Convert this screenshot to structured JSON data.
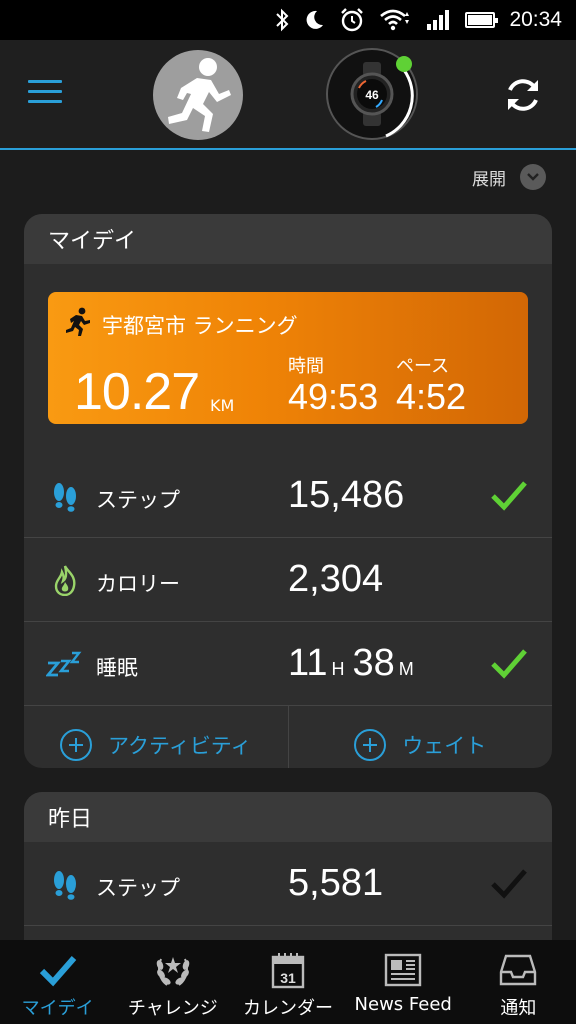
{
  "status_bar": {
    "time": "20:34"
  },
  "header": {
    "menu_icon": "hamburger-icon",
    "avatar_icon": "runner-avatar",
    "device_icon": "watch-device",
    "device_time": "46",
    "sync_icon": "sync-icon",
    "accent_color": "#2a9fd8"
  },
  "expand": {
    "label": "展開"
  },
  "my_day": {
    "title": "マイデイ",
    "activity": {
      "title": "宇都宮市 ランニング",
      "distance": "10.27",
      "distance_unit": "KM",
      "time_label": "時間",
      "time_value": "49:53",
      "pace_label": "ペース",
      "pace_value": "4:52",
      "color_start": "#f99a12",
      "color_end": "#d26705"
    },
    "stats": [
      {
        "label": "ステップ",
        "value": "15,486",
        "icon": "footsteps-icon",
        "checked": true
      },
      {
        "label": "カロリー",
        "value": "2,304",
        "icon": "flame-icon",
        "checked": false
      },
      {
        "label": "睡眠",
        "hours": "11",
        "hours_unit": "H",
        "minutes": "38",
        "minutes_unit": "M",
        "icon": "sleep-icon",
        "checked": true
      }
    ],
    "actions": [
      {
        "label": "アクティビティ"
      },
      {
        "label": "ウェイト"
      }
    ]
  },
  "yesterday": {
    "title": "昨日",
    "stats": [
      {
        "label": "ステップ",
        "value": "5,581",
        "icon": "footsteps-icon",
        "checked": false
      }
    ]
  },
  "bottom_nav": [
    {
      "label": "マイデイ",
      "icon": "check-icon",
      "active": true
    },
    {
      "label": "チャレンジ",
      "icon": "laurel-icon",
      "active": false
    },
    {
      "label": "カレンダー",
      "icon": "calendar-icon",
      "day": "31",
      "active": false
    },
    {
      "label": "News Feed",
      "icon": "newspaper-icon",
      "active": false
    },
    {
      "label": "通知",
      "icon": "inbox-icon",
      "active": false
    }
  ]
}
